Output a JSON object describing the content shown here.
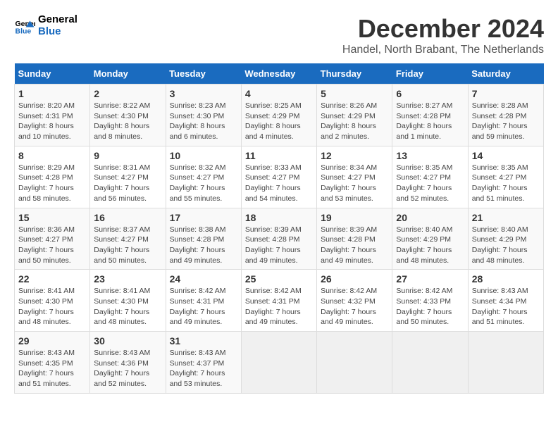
{
  "logo": {
    "line1": "General",
    "line2": "Blue"
  },
  "title": "December 2024",
  "subtitle": "Handel, North Brabant, The Netherlands",
  "weekdays": [
    "Sunday",
    "Monday",
    "Tuesday",
    "Wednesday",
    "Thursday",
    "Friday",
    "Saturday"
  ],
  "weeks": [
    [
      {
        "day": 1,
        "info": "Sunrise: 8:20 AM\nSunset: 4:31 PM\nDaylight: 8 hours\nand 10 minutes."
      },
      {
        "day": 2,
        "info": "Sunrise: 8:22 AM\nSunset: 4:30 PM\nDaylight: 8 hours\nand 8 minutes."
      },
      {
        "day": 3,
        "info": "Sunrise: 8:23 AM\nSunset: 4:30 PM\nDaylight: 8 hours\nand 6 minutes."
      },
      {
        "day": 4,
        "info": "Sunrise: 8:25 AM\nSunset: 4:29 PM\nDaylight: 8 hours\nand 4 minutes."
      },
      {
        "day": 5,
        "info": "Sunrise: 8:26 AM\nSunset: 4:29 PM\nDaylight: 8 hours\nand 2 minutes."
      },
      {
        "day": 6,
        "info": "Sunrise: 8:27 AM\nSunset: 4:28 PM\nDaylight: 8 hours\nand 1 minute."
      },
      {
        "day": 7,
        "info": "Sunrise: 8:28 AM\nSunset: 4:28 PM\nDaylight: 7 hours\nand 59 minutes."
      }
    ],
    [
      {
        "day": 8,
        "info": "Sunrise: 8:29 AM\nSunset: 4:28 PM\nDaylight: 7 hours\nand 58 minutes."
      },
      {
        "day": 9,
        "info": "Sunrise: 8:31 AM\nSunset: 4:27 PM\nDaylight: 7 hours\nand 56 minutes."
      },
      {
        "day": 10,
        "info": "Sunrise: 8:32 AM\nSunset: 4:27 PM\nDaylight: 7 hours\nand 55 minutes."
      },
      {
        "day": 11,
        "info": "Sunrise: 8:33 AM\nSunset: 4:27 PM\nDaylight: 7 hours\nand 54 minutes."
      },
      {
        "day": 12,
        "info": "Sunrise: 8:34 AM\nSunset: 4:27 PM\nDaylight: 7 hours\nand 53 minutes."
      },
      {
        "day": 13,
        "info": "Sunrise: 8:35 AM\nSunset: 4:27 PM\nDaylight: 7 hours\nand 52 minutes."
      },
      {
        "day": 14,
        "info": "Sunrise: 8:35 AM\nSunset: 4:27 PM\nDaylight: 7 hours\nand 51 minutes."
      }
    ],
    [
      {
        "day": 15,
        "info": "Sunrise: 8:36 AM\nSunset: 4:27 PM\nDaylight: 7 hours\nand 50 minutes."
      },
      {
        "day": 16,
        "info": "Sunrise: 8:37 AM\nSunset: 4:27 PM\nDaylight: 7 hours\nand 50 minutes."
      },
      {
        "day": 17,
        "info": "Sunrise: 8:38 AM\nSunset: 4:28 PM\nDaylight: 7 hours\nand 49 minutes."
      },
      {
        "day": 18,
        "info": "Sunrise: 8:39 AM\nSunset: 4:28 PM\nDaylight: 7 hours\nand 49 minutes."
      },
      {
        "day": 19,
        "info": "Sunrise: 8:39 AM\nSunset: 4:28 PM\nDaylight: 7 hours\nand 49 minutes."
      },
      {
        "day": 20,
        "info": "Sunrise: 8:40 AM\nSunset: 4:29 PM\nDaylight: 7 hours\nand 48 minutes."
      },
      {
        "day": 21,
        "info": "Sunrise: 8:40 AM\nSunset: 4:29 PM\nDaylight: 7 hours\nand 48 minutes."
      }
    ],
    [
      {
        "day": 22,
        "info": "Sunrise: 8:41 AM\nSunset: 4:30 PM\nDaylight: 7 hours\nand 48 minutes."
      },
      {
        "day": 23,
        "info": "Sunrise: 8:41 AM\nSunset: 4:30 PM\nDaylight: 7 hours\nand 48 minutes."
      },
      {
        "day": 24,
        "info": "Sunrise: 8:42 AM\nSunset: 4:31 PM\nDaylight: 7 hours\nand 49 minutes."
      },
      {
        "day": 25,
        "info": "Sunrise: 8:42 AM\nSunset: 4:31 PM\nDaylight: 7 hours\nand 49 minutes."
      },
      {
        "day": 26,
        "info": "Sunrise: 8:42 AM\nSunset: 4:32 PM\nDaylight: 7 hours\nand 49 minutes."
      },
      {
        "day": 27,
        "info": "Sunrise: 8:42 AM\nSunset: 4:33 PM\nDaylight: 7 hours\nand 50 minutes."
      },
      {
        "day": 28,
        "info": "Sunrise: 8:43 AM\nSunset: 4:34 PM\nDaylight: 7 hours\nand 51 minutes."
      }
    ],
    [
      {
        "day": 29,
        "info": "Sunrise: 8:43 AM\nSunset: 4:35 PM\nDaylight: 7 hours\nand 51 minutes."
      },
      {
        "day": 30,
        "info": "Sunrise: 8:43 AM\nSunset: 4:36 PM\nDaylight: 7 hours\nand 52 minutes."
      },
      {
        "day": 31,
        "info": "Sunrise: 8:43 AM\nSunset: 4:37 PM\nDaylight: 7 hours\nand 53 minutes."
      },
      null,
      null,
      null,
      null
    ]
  ]
}
